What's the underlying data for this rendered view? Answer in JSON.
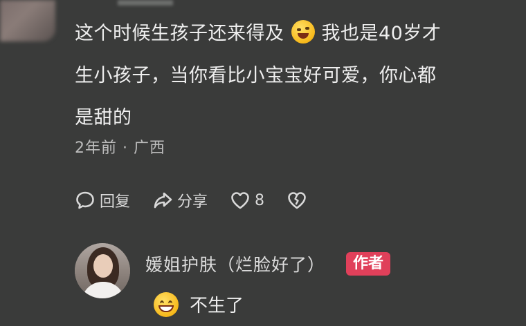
{
  "comment": {
    "line1_before_emoji": "这个时候生孩子还来得及",
    "emoji": "grinning-squint-face",
    "line1_after_emoji": "我也是40岁才",
    "line2": "生小孩子，当你看比小宝宝好可爱，你心都",
    "line3": "是甜的",
    "meta": "2年前 · 广西"
  },
  "actions": {
    "reply_label": "回复",
    "share_label": "分享",
    "like_count": "8"
  },
  "reply": {
    "author_name": "媛姐护肤（烂脸好了）",
    "author_badge": "作者",
    "emoji": "grinning-face",
    "text": "不生了"
  },
  "colors": {
    "background": "#3a3b3a",
    "badge": "#e0405a",
    "text": "#efefef",
    "meta": "#bdbdbd"
  }
}
